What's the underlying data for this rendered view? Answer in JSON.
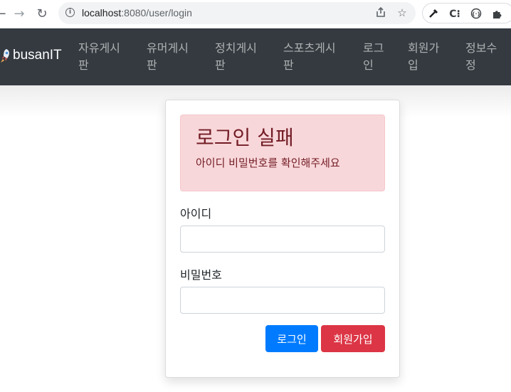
{
  "browser": {
    "url_host": "localhost",
    "url_rest": ":8080/user/login",
    "icons": {
      "back": "back-arrow-icon",
      "forward": "forward-arrow-icon",
      "reload": "reload-icon",
      "site_info": "info-icon",
      "share": "share-icon",
      "bookmark": "star-icon",
      "extensions": [
        "eyedropper-icon",
        "c-extension-icon",
        "dev-tools-icon",
        "puzzle-icon"
      ]
    }
  },
  "navbar": {
    "brand": "busanIT",
    "brand_icon": "rocket-icon",
    "items": [
      {
        "label": "자유게시\n판"
      },
      {
        "label": "유머게시\n판"
      },
      {
        "label": "정치게시\n판"
      },
      {
        "label": "스포츠게시\n판"
      },
      {
        "label": "로그\n인"
      },
      {
        "label": "회원가\n입"
      },
      {
        "label": "정보수\n정"
      }
    ]
  },
  "login": {
    "alert_title": "로그인 실패",
    "alert_message": "아이디 비밀번호를 확인해주세요",
    "username_label": "아이디",
    "username_value": "",
    "password_label": "비밀번호",
    "password_value": "",
    "login_button": "로그인",
    "signup_button": "회원가입"
  },
  "colors": {
    "navbar_bg": "#343a40",
    "alert_bg": "#f8d7da",
    "alert_text": "#721c24",
    "primary": "#007bff",
    "danger": "#dc3545"
  }
}
